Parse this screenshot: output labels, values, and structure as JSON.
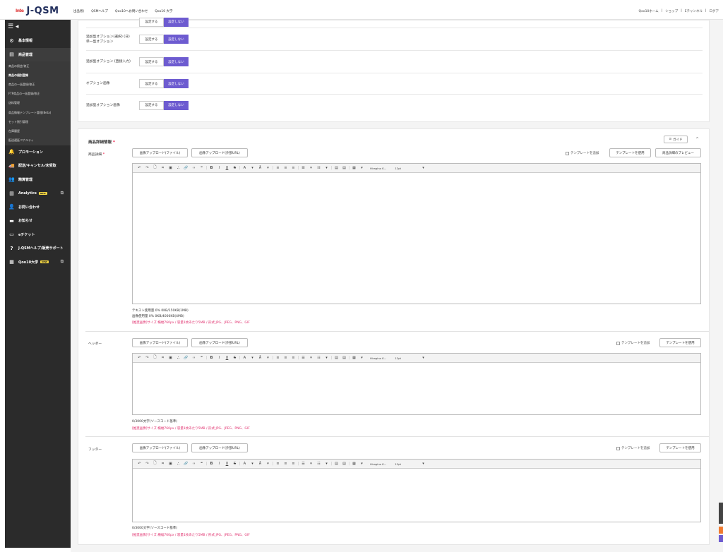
{
  "brand": {
    "mark": "Inte",
    "name": "J-QSM"
  },
  "topnav": [
    "出品者(",
    "QSMヘルプ",
    "Qoo10へお問い合わせ",
    "Qoo10 大学"
  ],
  "topright": [
    "Qoo10ホーム",
    "|",
    "ショップ",
    "|",
    "Eチャンネル",
    "|",
    "ログア"
  ],
  "sidebar": {
    "toggle": "☰ ◂",
    "items": [
      {
        "icon": "⚙",
        "label": "基本情報",
        "active": false
      },
      {
        "icon": "▤",
        "label": "商品管理",
        "active": true
      }
    ],
    "sub": [
      "商品の照会/修正",
      "商品の個別登録",
      "商品の一括登録/修正",
      "FTP商品の一括登録/修正",
      "送料管理",
      "商品情報テンプレート管理(Beta)",
      "セット割引管理",
      "在庫履歴",
      "配送遅延ペナルティ"
    ],
    "items2": [
      {
        "icon": "🔔",
        "label": "プロモーション",
        "badge": "",
        "ext": false
      },
      {
        "icon": "🚚",
        "label": "配送/キャンセル/未受取",
        "badge": "",
        "ext": false
      },
      {
        "icon": "👥",
        "label": "精算管理",
        "badge": "",
        "ext": false
      },
      {
        "icon": "▥",
        "label": "Analytics",
        "badge": "NEW",
        "ext": true
      },
      {
        "icon": "👤",
        "label": "お問い合わせ",
        "badge": "",
        "ext": false
      },
      {
        "icon": "▬",
        "label": "お知らせ",
        "badge": "",
        "ext": false
      },
      {
        "icon": "▭",
        "label": "eチケット",
        "badge": "",
        "ext": false
      },
      {
        "icon": "?",
        "label": "J-QSMヘルプ/販売サポート",
        "badge": "",
        "ext": false
      },
      {
        "icon": "▦",
        "label": "Qoo10大学",
        "badge": "NEW",
        "ext": true
      }
    ]
  },
  "options": {
    "on_label": "設定する",
    "off_label": "設定しない",
    "rows": [
      {
        "label": ""
      },
      {
        "label": "追加型オプション(選択) (日)単一型オプション"
      },
      {
        "label": "追加型オプション (直接入力)"
      },
      {
        "label": "オプション画像"
      },
      {
        "label": "追加型オプション画像"
      }
    ]
  },
  "detail": {
    "title": "商品詳細情報",
    "required_mark": "*",
    "guide_label": "ガイド",
    "collapse": "^",
    "upload_file": "画像アップロード(ファイル)",
    "upload_url": "画像アップロード(外部URL)",
    "template_add": "テンプレートを追加",
    "template_use": "テンプレートを使用",
    "preview": "商品詳細のプレビュー",
    "toolbar": {
      "groups": [
        "↶",
        "↷",
        "🗋",
        "⌗",
        "▣",
        "⛬",
        "🔗",
        "‹›",
        "❝",
        "|",
        "B",
        "I",
        "U",
        "S",
        "|",
        "A",
        "▾",
        "Ā",
        "▾",
        "|",
        "≡",
        "≡",
        "≡",
        "|",
        "☰",
        "▾",
        "☷",
        "▾",
        "|",
        "▤",
        "▤",
        "|",
        "▦",
        "▾"
      ],
      "font": "Hiragino K...",
      "size": "12pt"
    },
    "sections": [
      {
        "label": "商品詳細",
        "required": true,
        "notes": [
          "テキスト使用量 0% 0KB/150KB(1MB)",
          "画像使用量 0% 0KB/4000KB(4MB)"
        ],
        "pink": "[推奨画像]サイズ:横幅760px / 容量1枚あたり5MB / 形式:JPG、JPEG、PNG、GIF"
      },
      {
        "label": "ヘッダー",
        "required": false,
        "notes": [
          "0/3000文字(ソースコード基準)"
        ],
        "pink": "[推奨画像]サイズ:横幅760px / 容量1枚あたり5MB / 形式:JPG、JPEG、PNG、GIF"
      },
      {
        "label": "フッター",
        "required": false,
        "notes": [
          "0/3000文字(ソースコード基準)"
        ],
        "pink": "[推奨画像]サイズ:横幅760px / 容量1枚あたり5MB / 形式:JPG、JPEG、PNG、GIF"
      }
    ]
  }
}
